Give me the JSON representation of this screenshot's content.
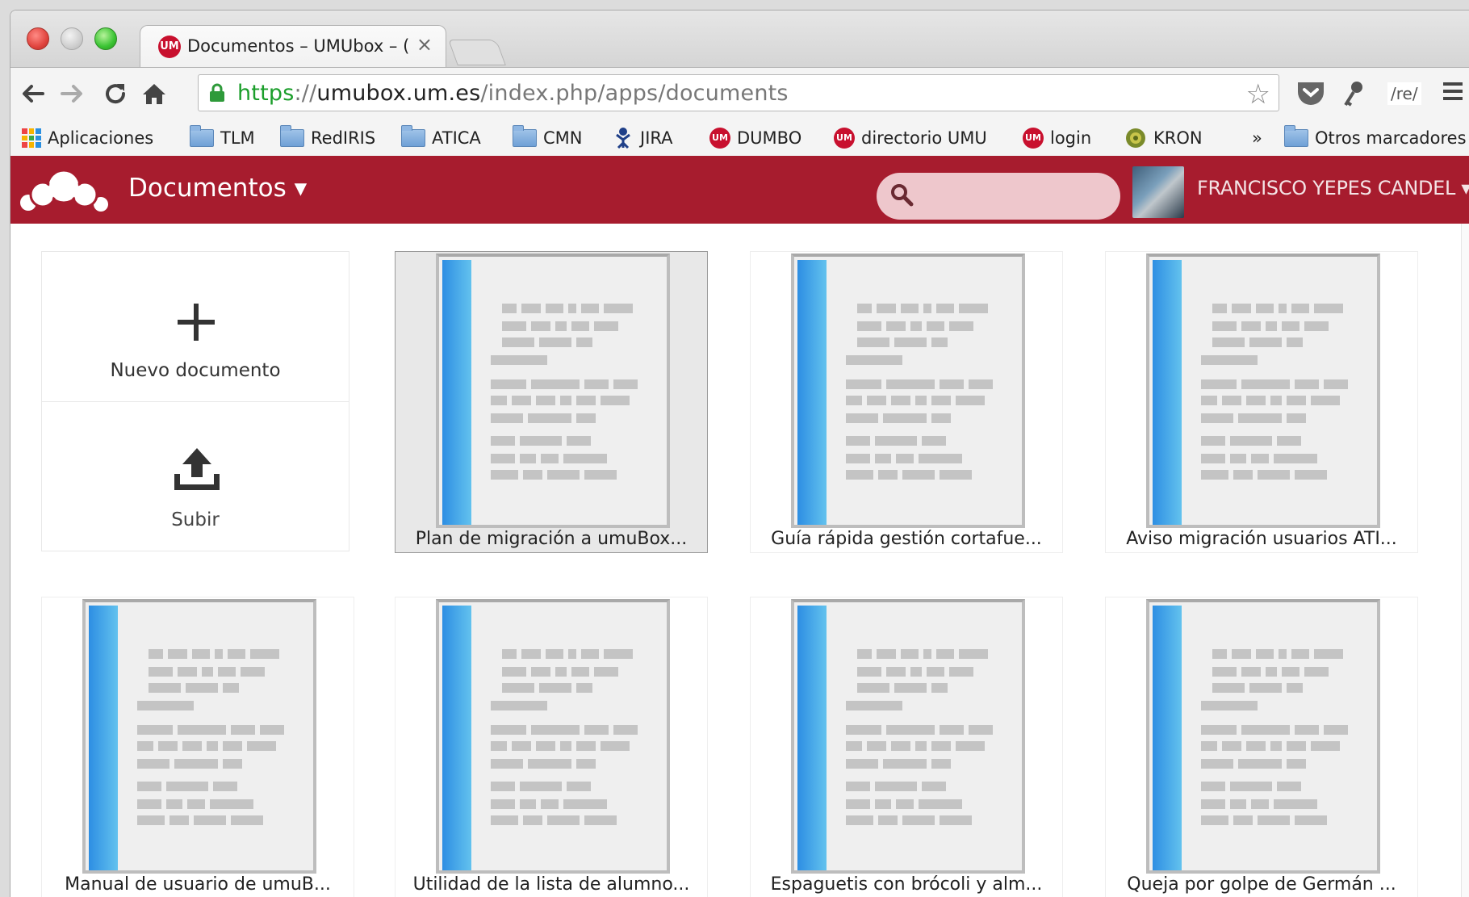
{
  "browser": {
    "tab_title": "Documentos – UMUbox – (",
    "tab_favicon": "UM",
    "url_scheme": "https",
    "url_sep": "://",
    "url_host": "umubox.um.es",
    "url_path": "/index.php/apps/documents",
    "ext_label": "/re/",
    "bookmarks": [
      {
        "label": "Aplicaciones",
        "icon": "apps-grid-icon"
      },
      {
        "label": "TLM",
        "icon": "folder-icon"
      },
      {
        "label": "RedIRIS",
        "icon": "folder-icon"
      },
      {
        "label": "ATICA",
        "icon": "folder-icon"
      },
      {
        "label": "CMN",
        "icon": "folder-icon"
      },
      {
        "label": "JIRA",
        "icon": "jira-icon"
      },
      {
        "label": "DUMBO",
        "icon": "um-icon"
      },
      {
        "label": "directorio UMU",
        "icon": "um-icon"
      },
      {
        "label": "login",
        "icon": "um-icon"
      },
      {
        "label": "KRON",
        "icon": "kron-icon"
      }
    ],
    "bookmarks_more": "»",
    "other_bookmarks": "Otros marcadores",
    "um_badge": "UM"
  },
  "app": {
    "title": "Documentos ▾",
    "search_placeholder": "",
    "user_name": "FRANCISCO YEPES CANDEL ▾",
    "brand_color": "#a71c2e"
  },
  "actions": {
    "new_document": "Nuevo documento",
    "upload": "Subir"
  },
  "documents": [
    {
      "name": "Plan de migración a umuBox...",
      "selected": true
    },
    {
      "name": "Guía rápida gestión cortafue...",
      "selected": false
    },
    {
      "name": "Aviso migración usuarios ATI...",
      "selected": false
    },
    {
      "name": "Manual de usuario de umuB...",
      "selected": false
    },
    {
      "name": "Utilidad de la lista de alumno...",
      "selected": false
    },
    {
      "name": "Espaguetis con brócoli y alm...",
      "selected": false
    },
    {
      "name": "Queja por golpe de Germán ...",
      "selected": false
    }
  ]
}
